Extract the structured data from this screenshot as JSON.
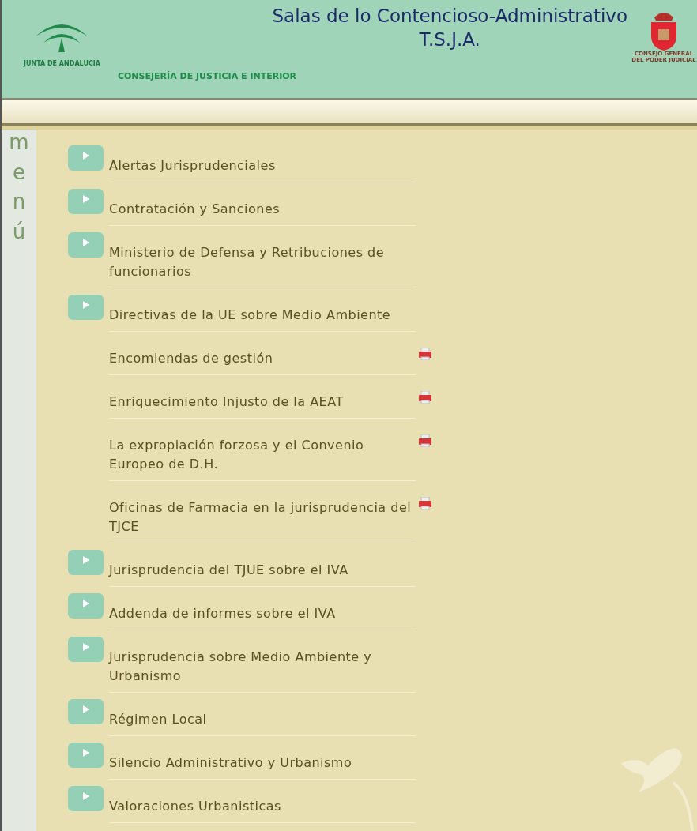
{
  "header": {
    "logo_left_text": "JUNTA DE ANDALUCIA",
    "department": "CONSEJERÍA DE JUSTICIA E INTERIOR",
    "title": [
      "Salas de lo Contencioso-Administrativo",
      "T.S.J.A."
    ],
    "logo_right_text": [
      "CONSEJO GENERAL",
      "DEL PODER JUDICIAL"
    ]
  },
  "sidebar": {
    "label": "menú"
  },
  "menu_items": [
    {
      "kind": "section",
      "label": "Alertas Jurisprudenciales"
    },
    {
      "kind": "section",
      "label": "Contratación y Sanciones"
    },
    {
      "kind": "section",
      "label": "Ministerio de Defensa y Retribuciones de funcionarios"
    },
    {
      "kind": "section",
      "label": "Directivas de la UE sobre Medio Ambiente"
    },
    {
      "kind": "document",
      "label": "Encomiendas de gestión"
    },
    {
      "kind": "document",
      "label": "Enriquecimiento Injusto de la AEAT"
    },
    {
      "kind": "document",
      "label": "La expropiación forzosa y el Convenio Europeo de D.H."
    },
    {
      "kind": "document",
      "label": "Oficinas de Farmacia en la jurisprudencia del TJCE"
    },
    {
      "kind": "section",
      "label": "Jurisprudencia del TJUE sobre el IVA"
    },
    {
      "kind": "section",
      "label": "Addenda de informes sobre el IVA"
    },
    {
      "kind": "section",
      "label": "Jurisprudencia sobre Medio Ambiente y Urbanismo"
    },
    {
      "kind": "section",
      "label": "Régimen Local"
    },
    {
      "kind": "section",
      "label": "Silencio Administrativo y Urbanismo"
    },
    {
      "kind": "section",
      "label": "Valoraciones Urbanisticas"
    }
  ]
}
